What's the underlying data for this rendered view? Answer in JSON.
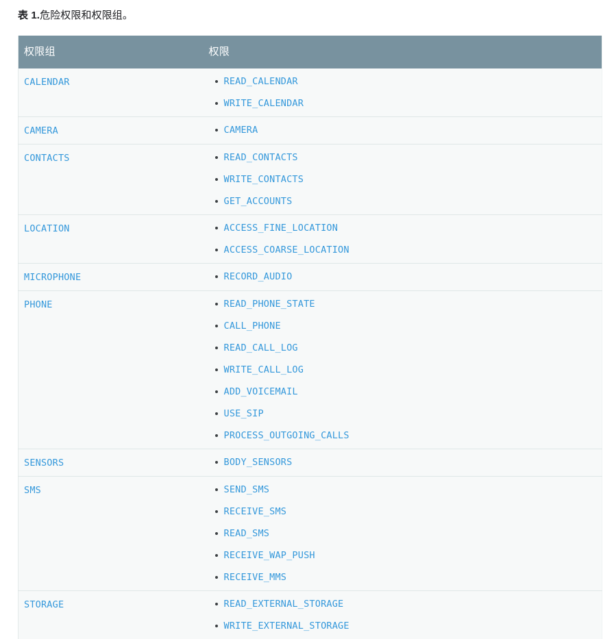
{
  "caption": {
    "label": "表 1.",
    "text": "危险权限和权限组。"
  },
  "colors": {
    "header_background": "#78929f",
    "header_text": "#ffffff",
    "row_background": "#f7f9f9",
    "link_blue": "#3498db",
    "row_divider": "#dfe7e7",
    "bullet": "#3c4043",
    "page_background": "#ffffff",
    "body_text": "#202124"
  },
  "table": {
    "columns": [
      {
        "key": "group",
        "label": "权限组"
      },
      {
        "key": "permissions",
        "label": "权限"
      }
    ],
    "rows": [
      {
        "group": "CALENDAR",
        "permissions": [
          "READ_CALENDAR",
          "WRITE_CALENDAR"
        ]
      },
      {
        "group": "CAMERA",
        "permissions": [
          "CAMERA"
        ]
      },
      {
        "group": "CONTACTS",
        "permissions": [
          "READ_CONTACTS",
          "WRITE_CONTACTS",
          "GET_ACCOUNTS"
        ]
      },
      {
        "group": "LOCATION",
        "permissions": [
          "ACCESS_FINE_LOCATION",
          "ACCESS_COARSE_LOCATION"
        ]
      },
      {
        "group": "MICROPHONE",
        "permissions": [
          "RECORD_AUDIO"
        ]
      },
      {
        "group": "PHONE",
        "permissions": [
          "READ_PHONE_STATE",
          "CALL_PHONE",
          "READ_CALL_LOG",
          "WRITE_CALL_LOG",
          "ADD_VOICEMAIL",
          "USE_SIP",
          "PROCESS_OUTGOING_CALLS"
        ]
      },
      {
        "group": "SENSORS",
        "permissions": [
          "BODY_SENSORS"
        ]
      },
      {
        "group": "SMS",
        "permissions": [
          "SEND_SMS",
          "RECEIVE_SMS",
          "READ_SMS",
          "RECEIVE_WAP_PUSH",
          "RECEIVE_MMS"
        ]
      },
      {
        "group": "STORAGE",
        "permissions": [
          "READ_EXTERNAL_STORAGE",
          "WRITE_EXTERNAL_STORAGE"
        ]
      }
    ]
  }
}
